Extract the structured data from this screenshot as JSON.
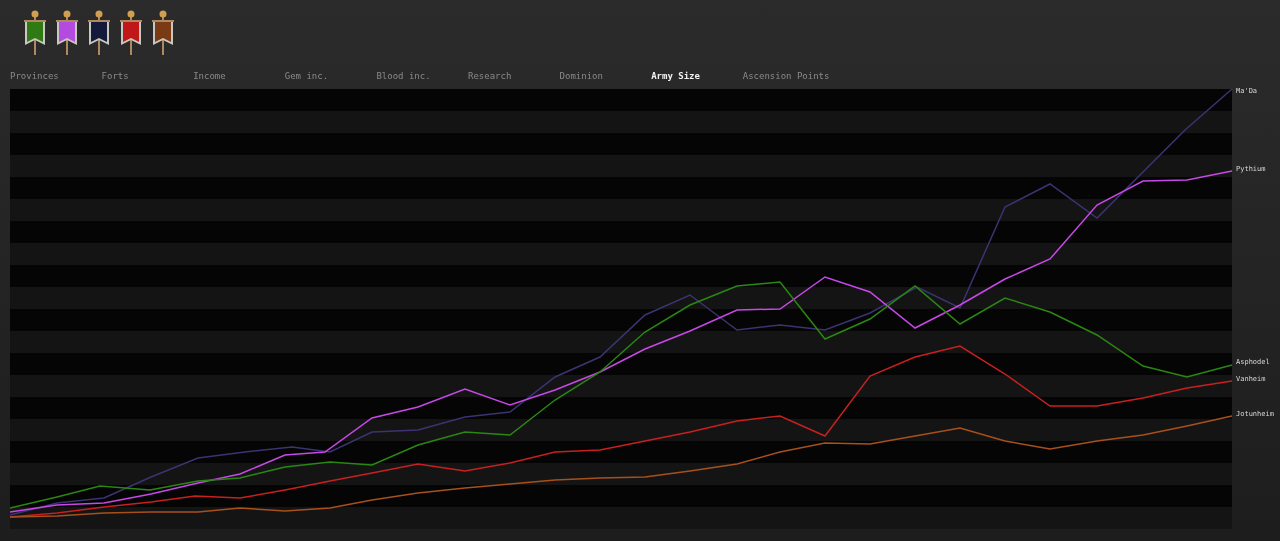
{
  "banners": [
    {
      "color": "#2f7a12"
    },
    {
      "color": "#b44be0"
    },
    {
      "color": "#151a3a"
    },
    {
      "color": "#c01818"
    },
    {
      "color": "#7a3a14"
    }
  ],
  "tabs": [
    {
      "label": "Provinces",
      "selected": false
    },
    {
      "label": "Forts",
      "selected": false
    },
    {
      "label": "Income",
      "selected": false
    },
    {
      "label": "Gem inc.",
      "selected": false
    },
    {
      "label": "Blood inc.",
      "selected": false
    },
    {
      "label": "Research",
      "selected": false
    },
    {
      "label": "Dominion",
      "selected": false
    },
    {
      "label": "Army Size",
      "selected": true
    },
    {
      "label": "Ascension Points",
      "selected": false
    }
  ],
  "chart": {
    "series": [
      {
        "label": "Ma'Da",
        "color": "#3a3472"
      },
      {
        "label": "Pythium",
        "color": "#c848e8"
      },
      {
        "label": "Asphodel",
        "color": "#2a8812"
      },
      {
        "label": "Vanheim",
        "color": "#c82020"
      },
      {
        "label": "Jotunheim",
        "color": "#a8501c"
      }
    ]
  }
}
